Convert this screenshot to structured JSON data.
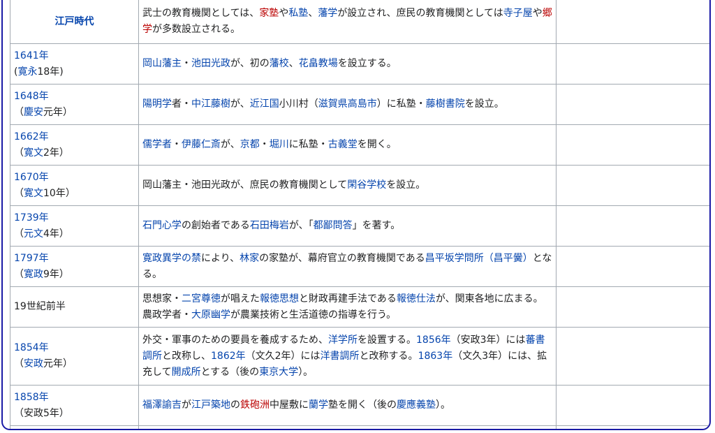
{
  "rows": [
    {
      "date": [
        {
          "t": "江戸時代",
          "k": "era"
        }
      ],
      "header": true,
      "event": [
        {
          "t": "武士の教育機関としては、"
        },
        {
          "t": "家塾",
          "k": "new"
        },
        {
          "t": "や"
        },
        {
          "t": "私塾",
          "k": "lk"
        },
        {
          "t": "、"
        },
        {
          "t": "藩学",
          "k": "lk"
        },
        {
          "t": "が設立され、庶民の教育機関としては"
        },
        {
          "t": "寺子屋",
          "k": "lk"
        },
        {
          "t": "や"
        },
        {
          "t": "郷学",
          "k": "new"
        },
        {
          "t": "が多数設立される。"
        }
      ],
      "height": 63
    },
    {
      "date": [
        {
          "t": "1641年",
          "k": "lk"
        },
        {
          "br": true
        },
        {
          "t": "("
        },
        {
          "t": "寛永",
          "k": "lk"
        },
        {
          "t": "18年)"
        }
      ],
      "event": [
        {
          "t": "岡山藩主",
          "k": "lk"
        },
        {
          "t": "・"
        },
        {
          "t": "池田光政",
          "k": "lk"
        },
        {
          "t": "が、初の"
        },
        {
          "t": "藩校",
          "k": "lk"
        },
        {
          "t": "、"
        },
        {
          "t": "花畠教場",
          "k": "lk"
        },
        {
          "t": "を設立する。"
        }
      ],
      "height": 58
    },
    {
      "date": [
        {
          "t": "1648年",
          "k": "lk"
        },
        {
          "br": true
        },
        {
          "t": "（"
        },
        {
          "t": "慶安",
          "k": "lk"
        },
        {
          "t": "元年）"
        }
      ],
      "event": [
        {
          "t": "陽明学",
          "k": "lk"
        },
        {
          "t": "者・"
        },
        {
          "t": "中江藤樹",
          "k": "lk"
        },
        {
          "t": "が、"
        },
        {
          "t": "近江国",
          "k": "lk"
        },
        {
          "t": "小川村（"
        },
        {
          "t": "滋賀県",
          "k": "lk"
        },
        {
          "t": "高島市",
          "k": "lk"
        },
        {
          "t": "）に私塾・"
        },
        {
          "t": "藤樹書院",
          "k": "lk"
        },
        {
          "t": "を設立。"
        }
      ],
      "height": 58
    },
    {
      "date": [
        {
          "t": "1662年",
          "k": "lk"
        },
        {
          "br": true
        },
        {
          "t": "（"
        },
        {
          "t": "寛文",
          "k": "lk"
        },
        {
          "t": "2年）"
        }
      ],
      "event": [
        {
          "t": "儒学者",
          "k": "lk"
        },
        {
          "t": "・"
        },
        {
          "t": "伊藤仁斎",
          "k": "lk"
        },
        {
          "t": "が、"
        },
        {
          "t": "京都",
          "k": "lk"
        },
        {
          "t": "・"
        },
        {
          "t": "堀川",
          "k": "lk"
        },
        {
          "t": "に私塾・"
        },
        {
          "t": "古義堂",
          "k": "lk"
        },
        {
          "t": "を開く。"
        }
      ],
      "height": 58
    },
    {
      "date": [
        {
          "t": "1670年",
          "k": "lk"
        },
        {
          "br": true
        },
        {
          "t": "（"
        },
        {
          "t": "寛文",
          "k": "lk"
        },
        {
          "t": "10年）"
        }
      ],
      "event": [
        {
          "t": "岡山藩主・池田光政が、庶民の教育機関として"
        },
        {
          "t": "閑谷学校",
          "k": "lk"
        },
        {
          "t": "を設立。"
        }
      ],
      "height": 58
    },
    {
      "date": [
        {
          "t": "1739年",
          "k": "lk"
        },
        {
          "br": true
        },
        {
          "t": "（"
        },
        {
          "t": "元文",
          "k": "lk"
        },
        {
          "t": "4年）"
        }
      ],
      "event": [
        {
          "t": "石門心学",
          "k": "lk"
        },
        {
          "t": "の創始者である"
        },
        {
          "t": "石田梅岩",
          "k": "lk"
        },
        {
          "t": "が、「"
        },
        {
          "t": "都鄙問答",
          "k": "lk"
        },
        {
          "t": "」を著す。"
        }
      ],
      "height": 58
    },
    {
      "date": [
        {
          "t": "1797年",
          "k": "lk"
        },
        {
          "br": true
        },
        {
          "t": "（"
        },
        {
          "t": "寛政",
          "k": "lk"
        },
        {
          "t": "9年）"
        }
      ],
      "event": [
        {
          "t": "寛政異学の禁",
          "k": "lk"
        },
        {
          "t": "により、"
        },
        {
          "t": "林家",
          "k": "lk"
        },
        {
          "t": "の家塾が、幕府官立の教育機関である"
        },
        {
          "t": "昌平坂学問所（昌平黌）",
          "k": "lk"
        },
        {
          "t": "となる。"
        }
      ],
      "height": 58
    },
    {
      "date": [
        {
          "t": "19世紀前半"
        }
      ],
      "event": [
        {
          "t": "思想家・"
        },
        {
          "t": "二宮尊徳",
          "k": "lk"
        },
        {
          "t": "が唱えた"
        },
        {
          "t": "報徳思想",
          "k": "lk"
        },
        {
          "t": "と財政再建手法である"
        },
        {
          "t": "報徳仕法",
          "k": "lk"
        },
        {
          "t": "が、関東各地に広まる。農政学者・"
        },
        {
          "t": "大原幽学",
          "k": "lk"
        },
        {
          "t": "が農業技術と生活道徳の指導を行う。"
        }
      ],
      "height": 58
    },
    {
      "date": [
        {
          "t": "1854年",
          "k": "lk"
        },
        {
          "br": true
        },
        {
          "t": "（"
        },
        {
          "t": "安政",
          "k": "lk"
        },
        {
          "t": "元年）"
        }
      ],
      "event": [
        {
          "t": "外交・軍事のための要員を養成するため、"
        },
        {
          "t": "洋学所",
          "k": "lk"
        },
        {
          "t": "を設置する。"
        },
        {
          "t": "1856年",
          "k": "lk"
        },
        {
          "t": "（安政3年）には"
        },
        {
          "t": "蕃書調所",
          "k": "lk"
        },
        {
          "t": "と改称し、"
        },
        {
          "t": "1862年",
          "k": "lk"
        },
        {
          "t": "（文久2年）には"
        },
        {
          "t": "洋書調所",
          "k": "lk"
        },
        {
          "t": "と改称する。"
        },
        {
          "t": "1863年",
          "k": "lk"
        },
        {
          "t": "（文久3年）には、拡充して"
        },
        {
          "t": "開成所",
          "k": "lk"
        },
        {
          "t": "とする（後の"
        },
        {
          "t": "東京大学",
          "k": "lk"
        },
        {
          "t": "）。"
        }
      ],
      "height": 83
    },
    {
      "date": [
        {
          "t": "1858年",
          "k": "lk"
        },
        {
          "br": true
        },
        {
          "t": "（安政5年）"
        }
      ],
      "event": [
        {
          "t": "福澤諭吉",
          "k": "lk"
        },
        {
          "t": "が"
        },
        {
          "t": "江戸",
          "k": "lk"
        },
        {
          "t": "築地",
          "k": "lk"
        },
        {
          "t": "の"
        },
        {
          "t": "鉄砲洲",
          "k": "new"
        },
        {
          "t": "中屋敷に"
        },
        {
          "t": "蘭学",
          "k": "lk"
        },
        {
          "t": "塾を開く（後の"
        },
        {
          "t": "慶應義塾",
          "k": "lk"
        },
        {
          "t": "）。"
        }
      ],
      "height": 58
    },
    {
      "date": [],
      "event": [],
      "height": 20
    }
  ]
}
